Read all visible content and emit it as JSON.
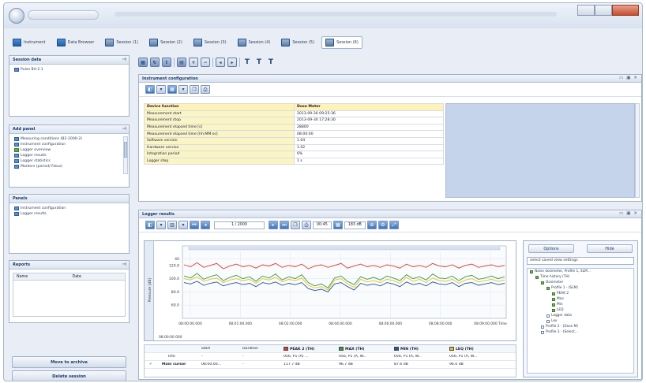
{
  "tabs": [
    {
      "label": "Instrument",
      "icon": "monitor-icon",
      "active": false
    },
    {
      "label": "Data Browser",
      "icon": "folder-icon",
      "active": false
    },
    {
      "label": "Session (1)",
      "icon": "session-icon",
      "active": false
    },
    {
      "label": "Session (2)",
      "icon": "session-icon",
      "active": false
    },
    {
      "label": "Session (3)",
      "icon": "session-icon",
      "active": false
    },
    {
      "label": "Session (4)",
      "icon": "session-icon",
      "active": false
    },
    {
      "label": "Session (5)",
      "icon": "session-icon",
      "active": false
    },
    {
      "label": "Session (6)",
      "icon": "session-icon",
      "active": true
    }
  ],
  "sidebar": {
    "session_data": {
      "title": "Session data",
      "items": [
        "Pulse BA-2.1"
      ]
    },
    "add_panel": {
      "title": "Add panel",
      "items": [
        "Measuring conditions (B2-1000-2)",
        "Instrument configuration",
        "Logger overview",
        "Logger results",
        "Logger statistics",
        "Markers (period/ Fatus)"
      ]
    },
    "panels": {
      "title": "Panels",
      "items": [
        "Instrument configuration",
        "Logger results"
      ]
    },
    "reports": {
      "title": "Reports",
      "col_name": "Name",
      "col_date": "Date"
    },
    "move_button": "Move to archive",
    "delete_button": "Delete session"
  },
  "config_panel": {
    "title": "Instrument configuration",
    "rows": [
      {
        "key": "Device function",
        "value": "Dose Meter"
      },
      {
        "key": "Measurement start",
        "value": "2013-09-30 09:25:36"
      },
      {
        "key": "Measurement stop",
        "value": "2013-09-30 17:28:30"
      },
      {
        "key": "Measurement elapsed time [s]",
        "value": "28800"
      },
      {
        "key": "Measurement elapsed time [hh:MM:ss]",
        "value": "08:00:00"
      },
      {
        "key": "Software version",
        "value": "1.04"
      },
      {
        "key": "Hardware version",
        "value": "1.02"
      },
      {
        "key": "Integration period",
        "value": "6%"
      },
      {
        "key": "Logger step",
        "value": "1 s"
      }
    ]
  },
  "logger_panel": {
    "title": "Logger results",
    "page": "1 / 2000",
    "time_a": "00:45",
    "time_b": "183 dB",
    "options_button": "Options",
    "hide_button": "Hide",
    "select_placeholder": "select saved view settings",
    "tree": [
      {
        "label": "Noise dosimeter, Profile 1, SLM...",
        "checked": true,
        "depth": 0
      },
      {
        "label": "Time history (TH)",
        "checked": true,
        "depth": 1
      },
      {
        "label": "Dosimeter",
        "checked": true,
        "depth": 2
      },
      {
        "label": "Profile 1 - (SLM)",
        "checked": true,
        "depth": 3
      },
      {
        "label": "PEAK 2",
        "checked": true,
        "depth": 4
      },
      {
        "label": "Max",
        "checked": true,
        "depth": 4
      },
      {
        "label": "Min",
        "checked": true,
        "depth": 4
      },
      {
        "label": "LEQ",
        "checked": true,
        "depth": 4
      },
      {
        "label": "Logger data",
        "checked": false,
        "depth": 3
      },
      {
        "label": "Lex",
        "checked": false,
        "depth": 3
      },
      {
        "label": "Profile 2 - (Dose M)",
        "checked": false,
        "depth": 2
      },
      {
        "label": "Profile 3 - (Select...",
        "checked": false,
        "depth": 2
      }
    ],
    "table": {
      "headers": [
        "Start",
        "Duration",
        "PEAK 2 (TH)",
        "MAX (TH)",
        "MIN (TH)",
        "LEQ (TH)"
      ],
      "rows": [
        {
          "name": "Info",
          "start": "-",
          "duration": "-",
          "c1": "056, P1 (A) ...",
          "c2": "056, P1 (A, W...",
          "c3": "056, P1 (A, W...",
          "c4": "056, P1 (A, W..."
        },
        {
          "name": "Main cursor",
          "start": "08:00:00...",
          "duration": "-",
          "c1": "117.7 dB",
          "c2": "96.7 dB",
          "c3": "87.6 dB",
          "c4": "96.0 dB"
        }
      ]
    }
  },
  "chart_data": {
    "type": "line",
    "ylabel": "Pressure [dB]",
    "ylim": [
      40,
      140
    ],
    "yticks": [
      "40",
      "120.0",
      "100.0",
      "80.0",
      "60.0"
    ],
    "xticks": [
      "08:00:00.000",
      "08:01:00.000",
      "08:02:00.000",
      "08:04:00.000",
      "08:06:00.000",
      "08:08:00.000",
      "08:09:00.000 Time"
    ],
    "x_extra_label": "08:00:00.000",
    "series": [
      {
        "name": "PEAK 2 (TH)",
        "color": "#d9412e",
        "values": [
          121,
          118,
          124,
          117,
          120,
          123,
          115,
          119,
          122,
          118,
          120,
          116,
          121,
          119,
          123,
          117,
          120,
          118,
          122,
          115,
          119,
          121,
          117,
          120,
          123,
          116,
          119,
          122,
          118,
          120,
          117,
          121,
          119,
          116,
          122,
          118,
          120,
          117,
          123,
          119,
          118,
          121,
          116,
          120,
          122,
          117,
          119,
          121,
          118,
          120
        ]
      },
      {
        "name": "MAX (TH)",
        "color": "#3a9a3a",
        "values": [
          104,
          101,
          108,
          99,
          103,
          106,
          97,
          102,
          105,
          100,
          103,
          96,
          104,
          101,
          107,
          98,
          103,
          100,
          106,
          94,
          89,
          92,
          86,
          101,
          104,
          96,
          91,
          103,
          99,
          102,
          98,
          104,
          101,
          97,
          106,
          100,
          103,
          98,
          107,
          101,
          100,
          104,
          97,
          103,
          105,
          99,
          101,
          104,
          100,
          103
        ]
      },
      {
        "name": "MIN (TH)",
        "color": "#2455a5",
        "values": [
          94,
          92,
          96,
          90,
          93,
          95,
          89,
          92,
          94,
          91,
          93,
          88,
          94,
          92,
          95,
          90,
          93,
          91,
          94,
          85,
          82,
          84,
          80,
          92,
          94,
          88,
          83,
          93,
          90,
          92,
          89,
          94,
          92,
          88,
          95,
          91,
          93,
          89,
          95,
          92,
          91,
          94,
          88,
          93,
          94,
          90,
          92,
          94,
          91,
          93
        ]
      },
      {
        "name": "LEQ (TH)",
        "color": "#e6c21c",
        "values": [
          100,
          98,
          103,
          96,
          99,
          101,
          94,
          98,
          100,
          97,
          99,
          93,
          100,
          98,
          102,
          95,
          99,
          97,
          101,
          90,
          86,
          88,
          83,
          98,
          100,
          92,
          87,
          99,
          95,
          97,
          94,
          99,
          97,
          93,
          102,
          96,
          99,
          94,
          101,
          97,
          96,
          99,
          93,
          98,
          100,
          95,
          97,
          99,
          96,
          98
        ]
      }
    ]
  }
}
